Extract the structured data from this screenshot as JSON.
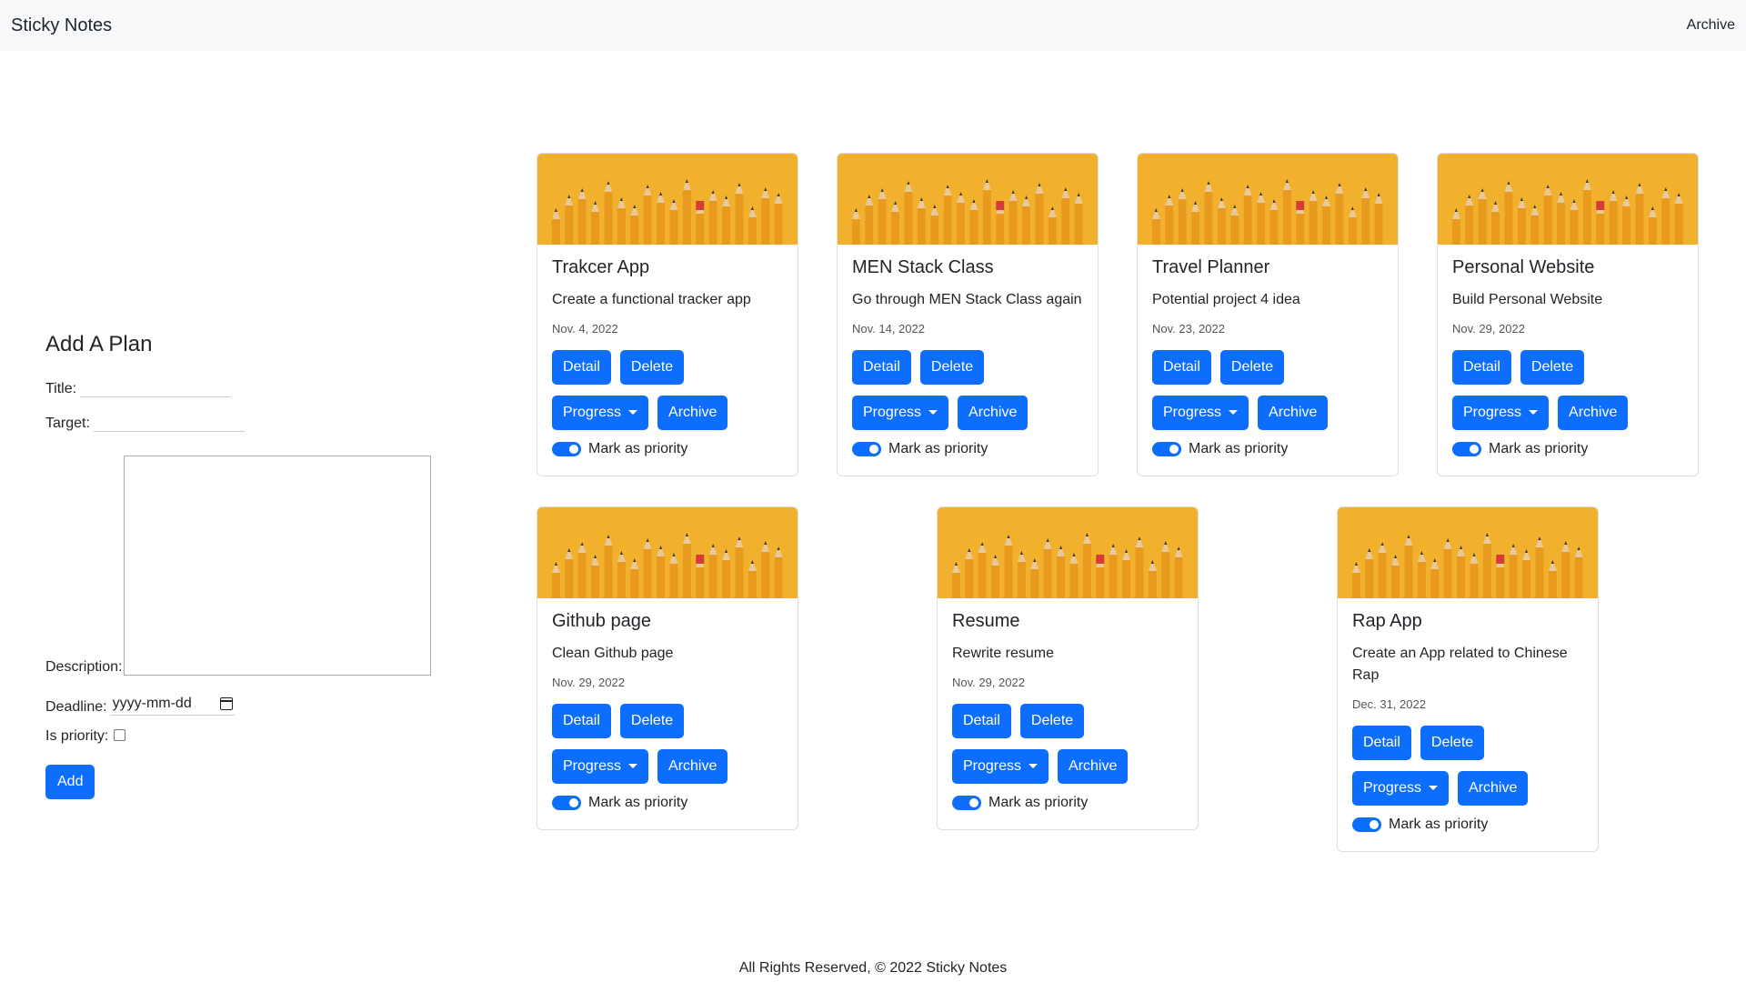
{
  "navbar": {
    "brand": "Sticky Notes",
    "archive_link": "Archive"
  },
  "form": {
    "heading": "Add A Plan",
    "title_label": "Title:",
    "target_label": "Target:",
    "description_label": "Description:",
    "deadline_label": "Deadline:",
    "deadline_placeholder": "yyyy-mm-dd",
    "priority_label": "Is priority:",
    "add_button": "Add"
  },
  "card_buttons": {
    "detail": "Detail",
    "delete": "Delete",
    "progress": "Progress",
    "archive": "Archive",
    "priority_toggle": "Mark as priority"
  },
  "cards": [
    {
      "title": "Trakcer App",
      "description": "Create a functional tracker app",
      "date": "Nov. 4, 2022",
      "priority": true
    },
    {
      "title": "MEN Stack Class",
      "description": "Go through MEN Stack Class again",
      "date": "Nov. 14, 2022",
      "priority": true
    },
    {
      "title": "Travel Planner",
      "description": "Potential project 4 idea",
      "date": "Nov. 23, 2022",
      "priority": true
    },
    {
      "title": "Personal Website",
      "description": "Build Personal Website",
      "date": "Nov. 29, 2022",
      "priority": true
    },
    {
      "title": "Github page",
      "description": "Clean Github page",
      "date": "Nov. 29, 2022",
      "priority": true
    },
    {
      "title": "Resume",
      "description": "Rewrite resume",
      "date": "Nov. 29, 2022",
      "priority": true
    },
    {
      "title": "Rap App",
      "description": "Create an App related to Chinese Rap",
      "date": "Dec. 31, 2022",
      "priority": true
    }
  ],
  "colors": {
    "primary": "#0d6efd",
    "navbar_bg": "#f8f9fa",
    "card_image_bg": "#f2b12c",
    "pencil": "#e89a1f"
  },
  "card_image_icon": "pencils-image",
  "footer": {
    "text": "All Rights Reserved, © 2022 Sticky Notes"
  }
}
